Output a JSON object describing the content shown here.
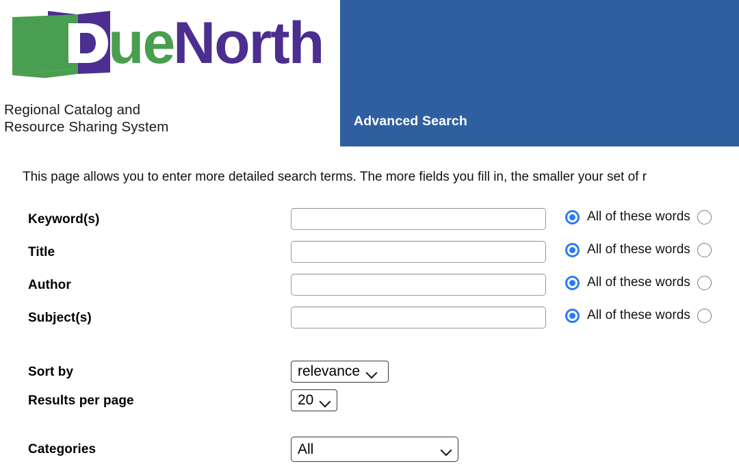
{
  "brand": {
    "logo_text_part1": "D",
    "logo_text_part2": "ue",
    "logo_text_part3": "North",
    "logo_icon": "open-book-icon",
    "tagline": "Regional Catalog and\nResource Sharing System",
    "colors": {
      "green": "#4a9e4f",
      "purple": "#4b2e8f",
      "banner_blue": "#2f5fa0",
      "radio_blue": "#2b7bf3"
    }
  },
  "banner": {
    "title": "Advanced Search"
  },
  "intro": {
    "text": "This page allows you to enter more detailed search terms. The more fields you fill in, the smaller your set of r"
  },
  "form": {
    "fields": [
      {
        "label": "Keyword(s)",
        "value": "",
        "placeholder": "",
        "match_selected_label": "All of these words"
      },
      {
        "label": "Title",
        "value": "",
        "placeholder": "",
        "match_selected_label": "All of these words"
      },
      {
        "label": "Author",
        "value": "",
        "placeholder": "",
        "match_selected_label": "All of these words"
      },
      {
        "label": "Subject(s)",
        "value": "",
        "placeholder": "",
        "match_selected_label": "All of these words"
      }
    ],
    "sort_by": {
      "label": "Sort by",
      "selected": "relevance"
    },
    "results_per_page": {
      "label": "Results per page",
      "selected": "20"
    },
    "categories": {
      "label": "Categories",
      "selected": "All"
    }
  }
}
